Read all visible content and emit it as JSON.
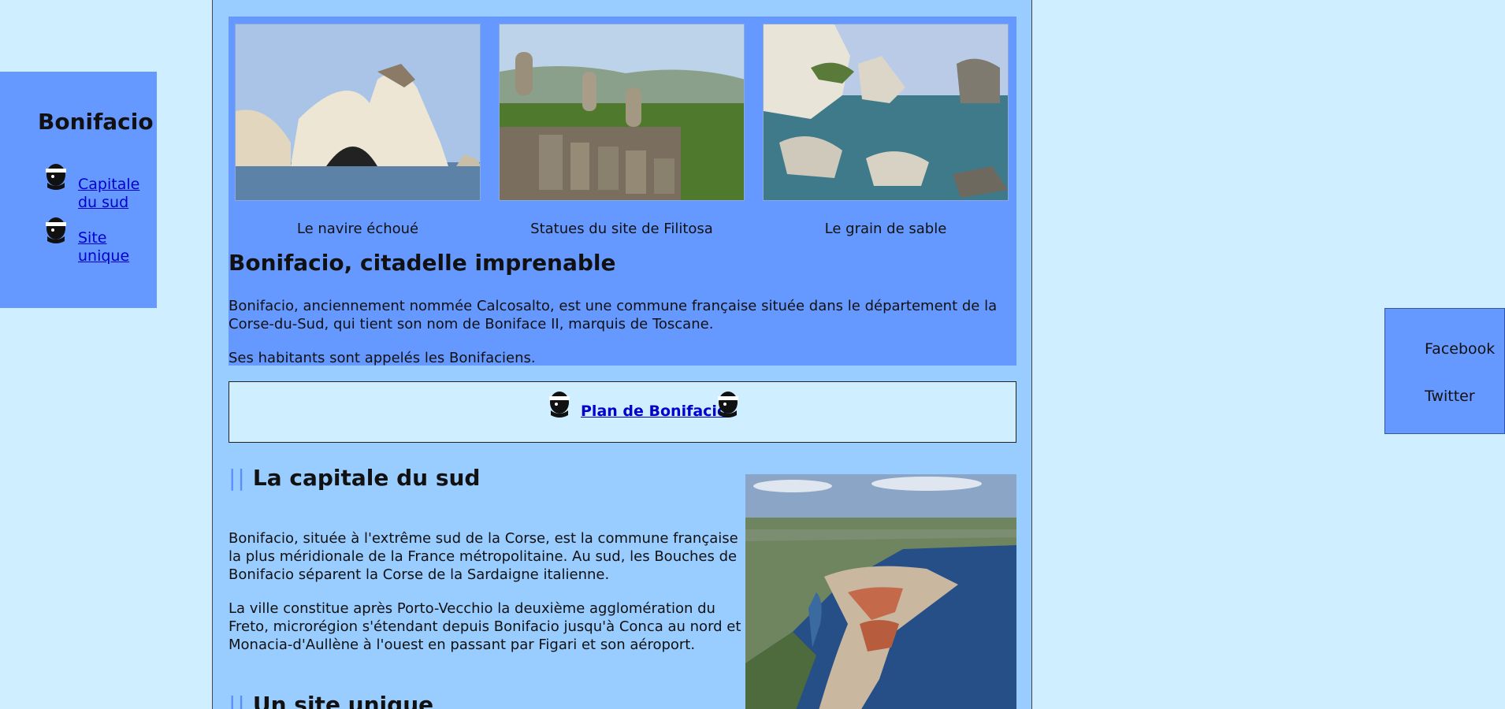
{
  "sidebar": {
    "title": "Bonifacio",
    "links": [
      {
        "label": "Capitale du sud"
      },
      {
        "label": "Site unique"
      }
    ]
  },
  "social": {
    "facebook": "Facebook",
    "twitter": "Twitter"
  },
  "gallery": [
    {
      "caption": "Le navire échoué",
      "icon": "cliff-photo"
    },
    {
      "caption": "Statues du site de Filitosa",
      "icon": "menhir-photo"
    },
    {
      "caption": "Le grain de sable",
      "icon": "coast-photo"
    }
  ],
  "intro": {
    "heading": "Bonifacio, citadelle imprenable",
    "paragraph1_line1": "Bonifacio, anciennement nommée Calcosalto, est une commune française située dans le département de la",
    "paragraph1_line2": "Corse-du-Sud, qui tient son nom de Boniface II, marquis de Toscane.",
    "paragraph2": "Ses habitants sont appelés les Bonifaciens."
  },
  "plan": {
    "link_label": "Plan de Bonifacio"
  },
  "section1": {
    "bars": "||",
    "title": "La capitale du sud",
    "p1_lines": [
      "Bonifacio, située à l'extrême sud de la Corse, est la commune française",
      "la plus méridionale de la France métropolitaine. Au sud, les Bouches de",
      "Bonifacio séparent la Corse de la Sardaigne italienne."
    ],
    "p2_lines": [
      "La ville constitue après Porto-Vecchio la deuxième agglomération du",
      "Freto, microrégion s'étendant depuis Bonifacio jusqu'à Conca au nord et",
      "Monacia-d'Aullène à l'ouest en passant par Figari et son aéroport."
    ]
  },
  "section2": {
    "bars": "||",
    "title": "Un site unique"
  },
  "colors": {
    "page_bg": "#cfeeff",
    "main_bg": "#99ccff",
    "panel_bg": "#6699ff",
    "link": "#0000cc"
  }
}
